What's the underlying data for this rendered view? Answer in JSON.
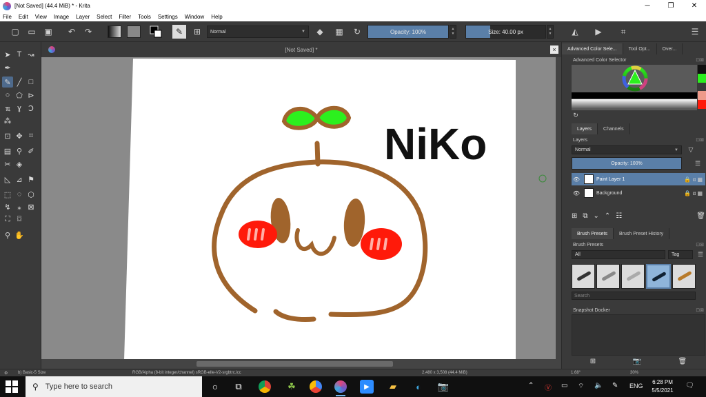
{
  "window": {
    "title": "[Not Saved]  (44.4 MiB)  * - Krita",
    "minimize": "─",
    "maximize": "❐",
    "close": "✕"
  },
  "menu": [
    "File",
    "Edit",
    "View",
    "Image",
    "Layer",
    "Select",
    "Filter",
    "Tools",
    "Settings",
    "Window",
    "Help"
  ],
  "toolbar": {
    "blend_mode": "Normal",
    "opacity_label": "Opacity: 100%",
    "opacity_value": 100,
    "size_label": "Size: 40.00 px",
    "size_fill": 0.3
  },
  "document": {
    "tab_title": "[Not Saved]  *",
    "close": "×",
    "drawing_text": "NiKo",
    "colors": {
      "sprout_green": "#2cf01e",
      "brown": "#a0642c",
      "cheek_red": "#ff1a0a",
      "ink": "#111111"
    }
  },
  "docker": {
    "top_tabs": [
      "Advanced Color Sele...",
      "Tool Opt...",
      "Over..."
    ],
    "color_selector_title": "Advanced Color Selector",
    "swatches": [
      "#111111",
      "#2cf01e",
      "#3a3a3a",
      "#ee9a8a",
      "#ff1a0a"
    ],
    "layer_tabs": [
      "Layers",
      "Channels"
    ],
    "layers_title": "Layers",
    "blend_mode": "Normal",
    "layer_opacity": "Opacity:  100%",
    "layers": [
      {
        "name": "Paint Layer 1",
        "selected": true
      },
      {
        "name": "Background",
        "selected": false
      }
    ],
    "brush_tabs": [
      "Brush Presets",
      "Brush Preset History"
    ],
    "brush_presets_title": "Brush Presets",
    "brush_filter": "All",
    "brush_tag": "Tag",
    "brush_search_placeholder": "Search",
    "snapshot_title": "Snapshot Docker"
  },
  "status": {
    "brush": "b) Basic-5 Size",
    "color_profile": "RGB/Alpha (8-bit integer/channel)  sRGB-elle-V2-srgbtrc.icc",
    "dimensions": "2,480 x 3,508 (44.4 MiB)",
    "rotation": "1.68°",
    "zoom": "30%"
  },
  "taskbar": {
    "search_placeholder": "Type here to search",
    "language": "ENG",
    "time": "6:28 PM",
    "date": "5/5/2021"
  }
}
